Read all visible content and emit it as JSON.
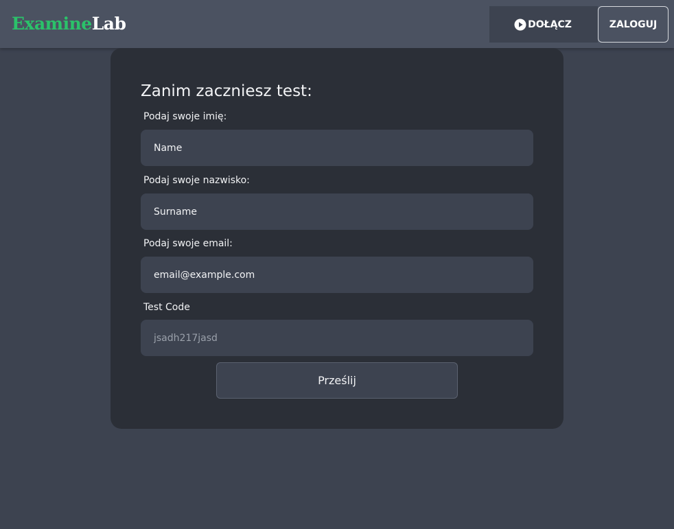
{
  "brand": {
    "part1": "Examine",
    "part2": "Lab",
    "accent_color": "#2bc26a"
  },
  "nav": {
    "join_label": "DOŁĄCZ",
    "join_icon": "play-circle-icon",
    "login_label": "ZALOGUJ"
  },
  "form": {
    "title": "Zanim zaczniesz test:",
    "fields": [
      {
        "label": "Podaj swoje imię:",
        "value": "Name",
        "placeholder": ""
      },
      {
        "label": "Podaj swoje nazwisko:",
        "value": "Surname",
        "placeholder": ""
      },
      {
        "label": "Podaj swoje email:",
        "value": "email@example.com",
        "placeholder": ""
      },
      {
        "label": "Test Code",
        "value": "",
        "placeholder": "jsadh217jasd"
      }
    ],
    "submit_label": "Prześlij"
  }
}
